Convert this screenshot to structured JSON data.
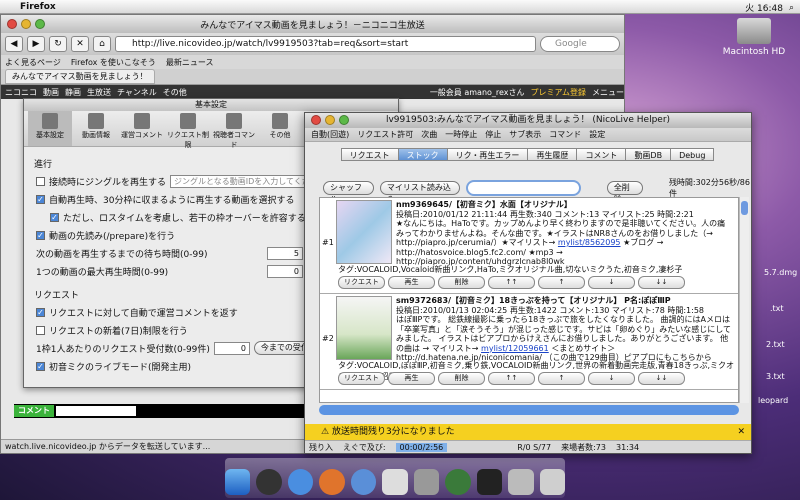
{
  "menubar": {
    "app": "Firefox",
    "clock": "火 16:48"
  },
  "firefox": {
    "title": "みんなでアイマス動画を見ましょう！－ニコニコ生放送",
    "url": "http://live.nicovideo.jp/watch/lv9919503?tab=req&sort=start",
    "search_placeholder": "Google",
    "bookmarks": [
      "よく見るページ",
      "Firefox を使いこなそう",
      "最新ニュース"
    ],
    "tab": "みんなでアイマス動画を見ましょう！",
    "nico_bar": [
      "ニコニコ",
      "動画",
      "静画",
      "生放送",
      "チャンネル",
      "その他"
    ],
    "nico_right": [
      "一般会員 amano_rexさん",
      "プレミアム登録",
      "メニュー"
    ],
    "status": "watch.live.nicovideo.jp からデータを転送しています..."
  },
  "settings": {
    "title": "基本設定",
    "tools": [
      "基本設定",
      "動画情報",
      "運営コメント",
      "リクエスト制限",
      "視聴者コマンド",
      "その他"
    ],
    "section1": "進行",
    "jingle": "接続時にジングルを再生する",
    "jingle_placeholder": "ジングルとなる動画IDを入力してくださ",
    "auto": "自動再生時、30分枠に収まるように再生する動画を選択する",
    "loss": "ただし、ロスタイムを考慮し、若干の枠オーバーを許容する",
    "prefetch": "動画の先読み(/prepare)を行う",
    "wait": "次の動画を再生するまでの待ち時間(0-99)",
    "wait_value": "5",
    "wait_unit": "秒",
    "maxtime": "1つの動画の最大再生時間(0-99)",
    "maxtime_value": "0",
    "maxtime_unit": "分",
    "section2": "リクエスト",
    "req_auto": "リクエストに対して自動で運営コメントを返す",
    "req_new": "リクエストの新着(7日)制限を行う",
    "per_person": "1枠1人あたりのリクエスト受付数(0-99件)",
    "per_person_value": "0",
    "per_person_btn": "今までの受付数",
    "miku": "初音ミクのライブモード(開発主用)",
    "comment_btn": "コメント"
  },
  "helper": {
    "title": "lv9919503:みんなでアイマス動画を見ましょう！ (NicoLive Helper)",
    "menu": [
      "自動(回遊)",
      "リクエスト許可",
      "次曲",
      "一時停止",
      "停止",
      "サブ表示",
      "コマンド",
      "設定"
    ],
    "tabs": [
      "リクエスト",
      "ストック",
      "リク・再生エラー",
      "再生履歴",
      "コメント",
      "動画DB",
      "Debug"
    ],
    "shuffle": "シャッフル",
    "mylist": "マイリスト読み込み",
    "delete_all": "全削除",
    "time": "残時間:302分56秒/86件",
    "items": [
      {
        "num": "#1",
        "id": "nm9369645/【初音ミク】水面【オリジナル】",
        "meta": "投稿日:2010/01/12 21:11:44 再生数:340 コメント:13 マイリスト:25 時間:2:21",
        "desc": "★なんにちは。HaToです。カップめんより早く終わりますので是非聴いてください。人の痛みってわかりませんよね。そんな曲です。★イラストはNR8さんのをお借りしました（→ http://piapro.jp/cerumia/）★マイリスト→",
        "link": "mylist/8562095",
        "desc2": "★ブログ → http://hatosvoice.blog5.fc2.com/ ★mp3 → http://piapro.jp/content/uhdgrzlcnab8l0wk",
        "tags": "タグ:VOCALOID,Vocaloid新曲リンク,HaTo,ミクオリジナル曲,切ないミクうた,初音ミク,凄杉子"
      },
      {
        "num": "#2",
        "id": "sm9372683/【初音ミク】18きっぷを持って【オリジナル】 P名:ぽぽⅢP",
        "meta": "投稿日:2010/01/13 02:04:25 再生数:1422 コメント:130 マイリスト:78 時間:1:58",
        "desc": "はぽⅢPです。 総鉄線撮影に乗ったら18きっぷで旅をしたくなりました。 曲調的にはAメロは「卒業写真」と「涙そうそう」が混じった感じです。サビは「卵めぐり」みたいな感じにしてみました。 イラストはビアプロからけえさんにお借りしました。ありがとうございます。 他の曲は → マイリスト→",
        "link": "mylist/12059661",
        "desc2": "＜まとめサイト＞http://d.hatena.ne.jp/niconicomania/ （この曲で129曲目）ピアプロにもこちらから",
        "tags": "タグ:VOCALOID,ぽぽⅢP,初音ミク,乗り鉄,VOCALOID新曲リンク,世界の新着動画完走版,青春18きっぷ,ミクオリジナル曲,昭和85年,JR"
      }
    ],
    "buttons": [
      "リクエスト",
      "再生",
      "削除",
      "↑↑",
      "↑",
      "↓",
      "↓↓"
    ],
    "alert": "放送時間残り3分になりました",
    "status_left": "残り入",
    "status_tab": "えぐで及び:",
    "status_time": "00:00/2:56",
    "status_r": "R/0 S/77",
    "status_viewers": "来場者数:73",
    "status_clock": "31:34"
  },
  "desktop": {
    "hd": "Macintosh HD",
    "labels": [
      "5.7.dmg",
      ".txt",
      "2.txt",
      "3.txt",
      "leopard"
    ]
  }
}
